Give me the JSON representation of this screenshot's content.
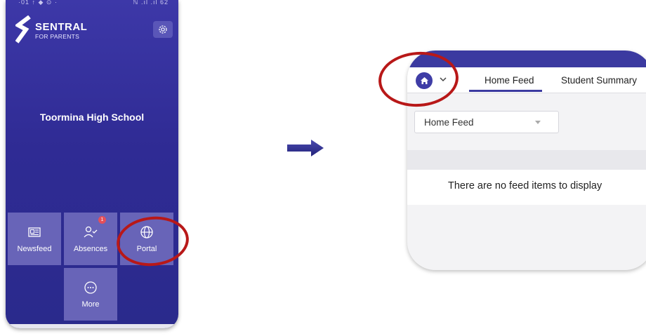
{
  "phone": {
    "statusbar": {
      "left": "·01 ↑ ◆ ⊙ ·",
      "right": "ℕ .ıl .ıl 62"
    },
    "app": {
      "title": "SENTRAL",
      "subtitle": "FOR PARENTS"
    },
    "school": "Toormina High School",
    "tiles": [
      {
        "label": "Newsfeed",
        "icon": "newspaper-icon"
      },
      {
        "label": "Absences",
        "icon": "user-check-icon",
        "badge": "1"
      },
      {
        "label": "Portal",
        "icon": "globe-icon"
      },
      {
        "label": "More",
        "icon": "more-icon"
      }
    ]
  },
  "web": {
    "tabs": [
      {
        "label": "Home Feed",
        "active": true
      },
      {
        "label": "Student Summary",
        "active": false
      }
    ],
    "select": {
      "value": "Home Feed"
    },
    "empty_message": "There are no feed items to display"
  },
  "colors": {
    "brand": "#3b3aa0",
    "tile": "#6864b8",
    "highlight_ring": "#b81818",
    "arrow": "#2f2f8f"
  }
}
